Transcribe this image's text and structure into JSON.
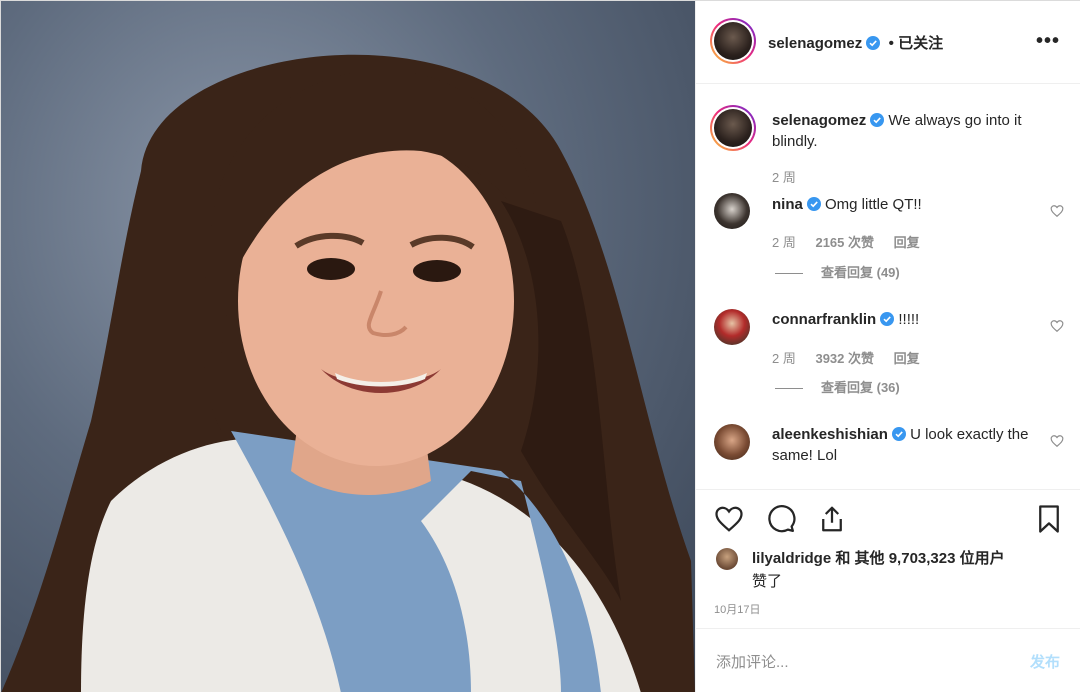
{
  "header": {
    "username": "selenagomez",
    "follow_status": "• 已关注",
    "more": "•••"
  },
  "caption": {
    "username": "selenagomez",
    "text": " We always go into it blindly.",
    "time": "2 周"
  },
  "comments": [
    {
      "username": "nina",
      "text": " Omg little QT!!",
      "time": "2 周",
      "likes": "2165 次赞",
      "reply": "回复",
      "view_replies": "查看回复 (49)"
    },
    {
      "username": "connarfranklin",
      "text": " !!!!!",
      "time": "2 周",
      "likes": "3932 次赞",
      "reply": "回复",
      "view_replies": "查看回复 (36)"
    },
    {
      "username": "aleenkeshishian",
      "text": " U look exactly the same! Lol"
    }
  ],
  "likes": {
    "liker": "lilyaldridge",
    "and": " 和 ",
    "others": "其他 9,703,323 位用户",
    "liked": "赞了"
  },
  "date": "10月17日",
  "add_comment": {
    "placeholder": "添加评论...",
    "post": "发布"
  },
  "colors": {
    "verified": "#3897f0",
    "post_disabled": "#b2dffc",
    "secondary_text": "#8e8e8e"
  },
  "icons": [
    "heart-icon",
    "comment-icon",
    "share-icon",
    "bookmark-icon",
    "verified-icon",
    "more-icon"
  ]
}
